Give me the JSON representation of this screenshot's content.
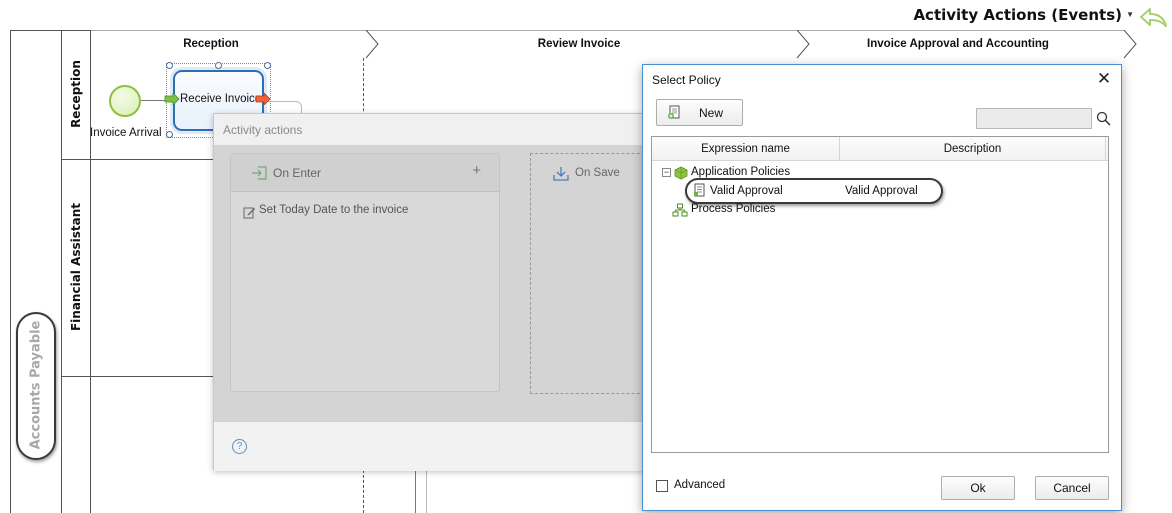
{
  "header": {
    "title": "Activity Actions (Events)"
  },
  "diagram": {
    "pool_label": "Accounts Payable",
    "lanes": [
      "Reception",
      "Financial Assistant"
    ],
    "phases": [
      "Reception",
      "Review Invoice",
      "Invoice Approval and Accounting"
    ],
    "start_event_label": "Invoice Arrival",
    "task_label": "Receive Invoice"
  },
  "activity_actions": {
    "title": "Activity actions",
    "on_enter_label": "On Enter",
    "on_enter_items": [
      "Set Today Date to the invoice"
    ],
    "on_save_label": "On Save",
    "add_symbol": "+",
    "help_symbol": "?"
  },
  "select_policy": {
    "title": "Select Policy",
    "close_symbol": "✕",
    "new_button": "New",
    "search_value": "",
    "columns": [
      "Expression name",
      "Description"
    ],
    "tree": {
      "application_policies": "Application Policies",
      "selected_row": {
        "name": "Valid Approval",
        "description": "Valid Approval"
      },
      "process_policies": "Process Policies"
    },
    "advanced_label": "Advanced",
    "ok_button": "Ok",
    "cancel_button": "Cancel"
  },
  "colors": {
    "accent_blue": "#2c6fb7",
    "start_green": "#8fbf3f",
    "back_arrow_green": "#a9cf6a"
  }
}
